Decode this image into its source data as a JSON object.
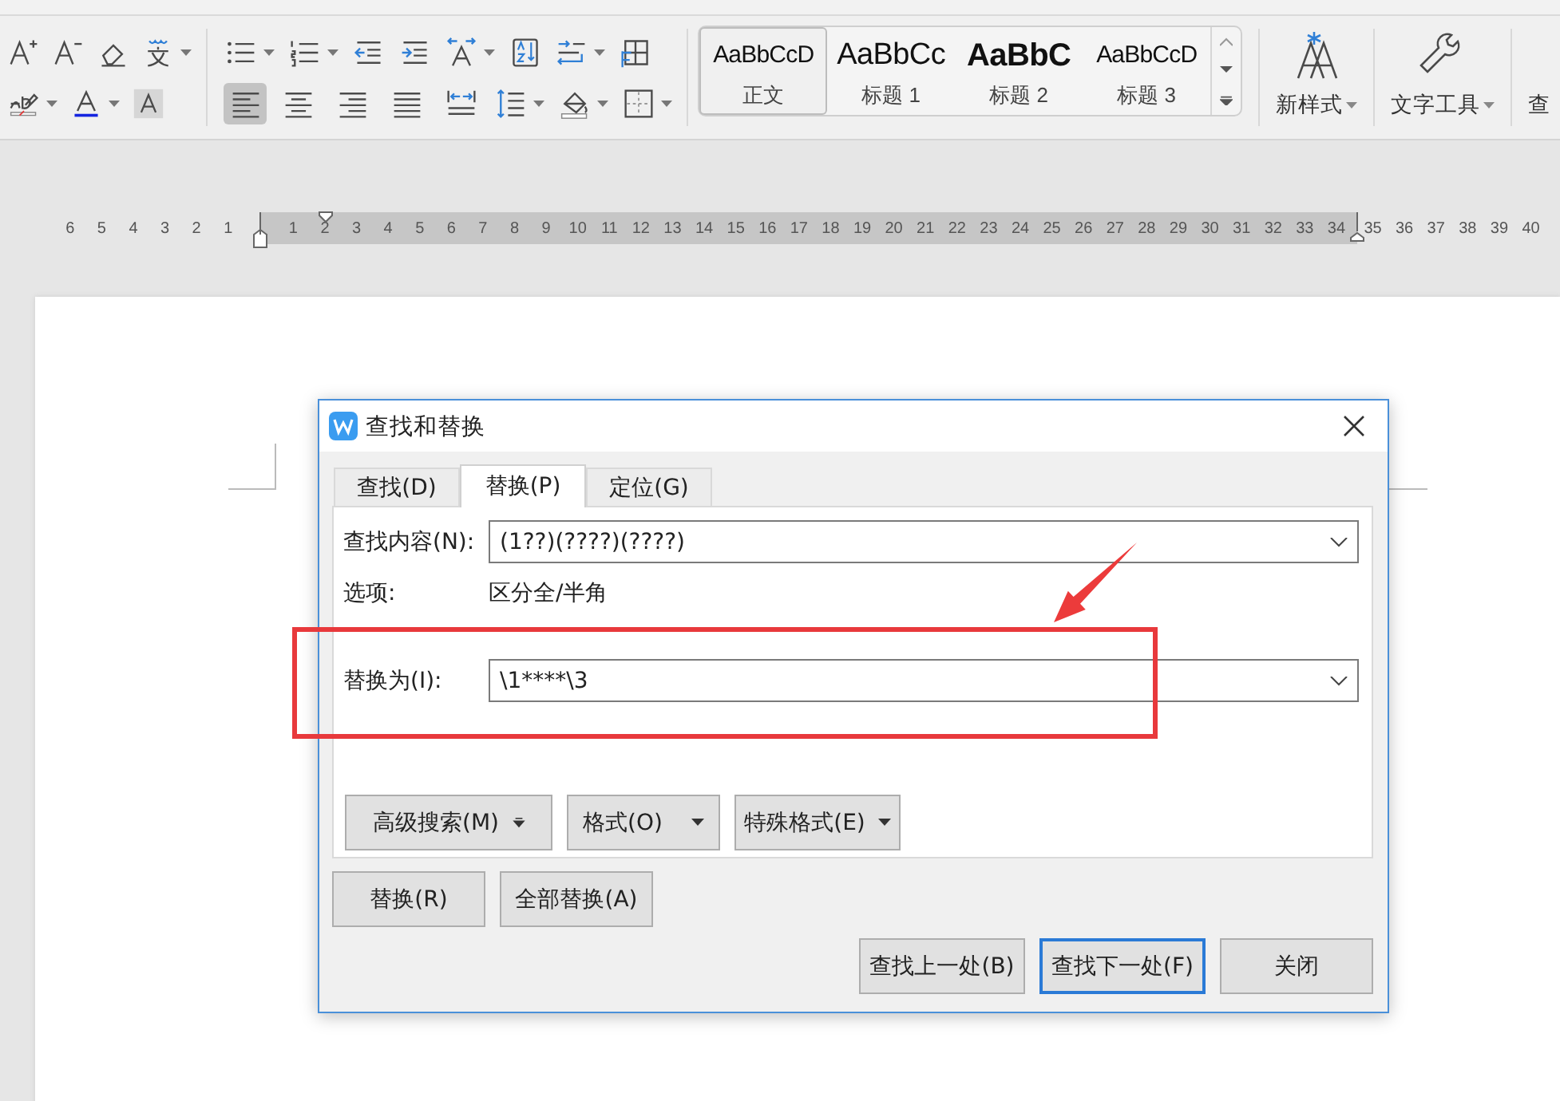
{
  "toolbar": {
    "font_rows": [
      [
        {
          "kind": "grow-font",
          "caret": false
        },
        {
          "kind": "shrink-font",
          "caret": false
        },
        {
          "kind": "eraser",
          "caret": false
        },
        {
          "kind": "pinyin",
          "caret": true
        }
      ],
      [
        {
          "kind": "highlight",
          "caret": true
        },
        {
          "kind": "font-color",
          "caret": true
        },
        {
          "kind": "char-shading",
          "caret": false
        }
      ]
    ],
    "paragraph_tools": [
      {
        "kind": "bullets",
        "caret": true
      },
      {
        "kind": "numbering",
        "caret": true
      },
      {
        "kind": "outdent",
        "caret": false
      },
      {
        "kind": "indent",
        "caret": false
      },
      {
        "kind": "char-scale",
        "caret": true
      },
      {
        "kind": "sort",
        "caret": false
      },
      {
        "kind": "line-break",
        "caret": true
      },
      {
        "kind": "table-grid",
        "caret": false
      }
    ],
    "alignment": [
      {
        "kind": "align-left",
        "selected": true
      },
      {
        "kind": "align-center",
        "selected": false
      },
      {
        "kind": "align-right",
        "selected": false
      },
      {
        "kind": "align-justify",
        "selected": false
      },
      {
        "kind": "align-distributed",
        "selected": false
      }
    ],
    "paragraph_tools_2": [
      {
        "kind": "line-spacing",
        "caret": true
      },
      {
        "kind": "fill",
        "caret": true
      },
      {
        "kind": "borders",
        "caret": true
      }
    ],
    "styles": [
      {
        "kind": "normal",
        "preview": "AaBbCcD",
        "label": "正文",
        "selected": true
      },
      {
        "kind": "heading1",
        "preview": "AaBbCc",
        "label": "标题 1",
        "selected": false
      },
      {
        "kind": "heading2",
        "preview": "AaBbC",
        "label": "标题 2",
        "selected": false
      },
      {
        "kind": "heading3",
        "preview": "AaBbCcD",
        "label": "标题 3",
        "selected": false
      }
    ],
    "big_buttons": [
      {
        "kind": "new-style",
        "label": "新样式",
        "caret": true
      },
      {
        "kind": "text-tools",
        "label": "文字工具",
        "caret": true
      },
      {
        "kind": "find",
        "label": "查",
        "caret": false
      }
    ]
  },
  "ruler": {
    "left_numbers": [
      "6",
      "5",
      "4",
      "3",
      "2",
      "1"
    ],
    "body_numbers": [
      "1",
      "2",
      "3",
      "4",
      "5",
      "6",
      "7",
      "8",
      "9",
      "10",
      "11",
      "12",
      "13",
      "14",
      "15",
      "16",
      "17",
      "18",
      "19",
      "20",
      "21",
      "22",
      "23",
      "24",
      "25",
      "26",
      "27",
      "28",
      "29",
      "30",
      "31",
      "32",
      "33",
      "34"
    ],
    "right_numbers": [
      "35",
      "36",
      "37",
      "38",
      "39",
      "40"
    ]
  },
  "dialog": {
    "title": "查找和替换",
    "tabs": [
      {
        "label": "查找(D)",
        "selected": false
      },
      {
        "label": "替换(P)",
        "selected": true
      },
      {
        "label": "定位(G)",
        "selected": false
      }
    ],
    "find_label": "查找内容(N):",
    "find_value": "(1??)(????)(????)",
    "options_label": "选项:",
    "options_value": "区分全/半角",
    "replace_label": "替换为(I):",
    "replace_value": "\\1****\\3",
    "menu_buttons": [
      {
        "label": "高级搜索(M)",
        "kind": "more"
      },
      {
        "label": "格式(O)",
        "kind": "dropdown"
      },
      {
        "label": "特殊格式(E)",
        "kind": "dropdown"
      }
    ],
    "replace_buttons": [
      "替换(R)",
      "全部替换(A)"
    ],
    "nav_buttons": [
      {
        "label": "查找上一处(B)",
        "focused": false
      },
      {
        "label": "查找下一处(F)",
        "focused": true
      },
      {
        "label": "关闭",
        "focused": false
      }
    ]
  }
}
